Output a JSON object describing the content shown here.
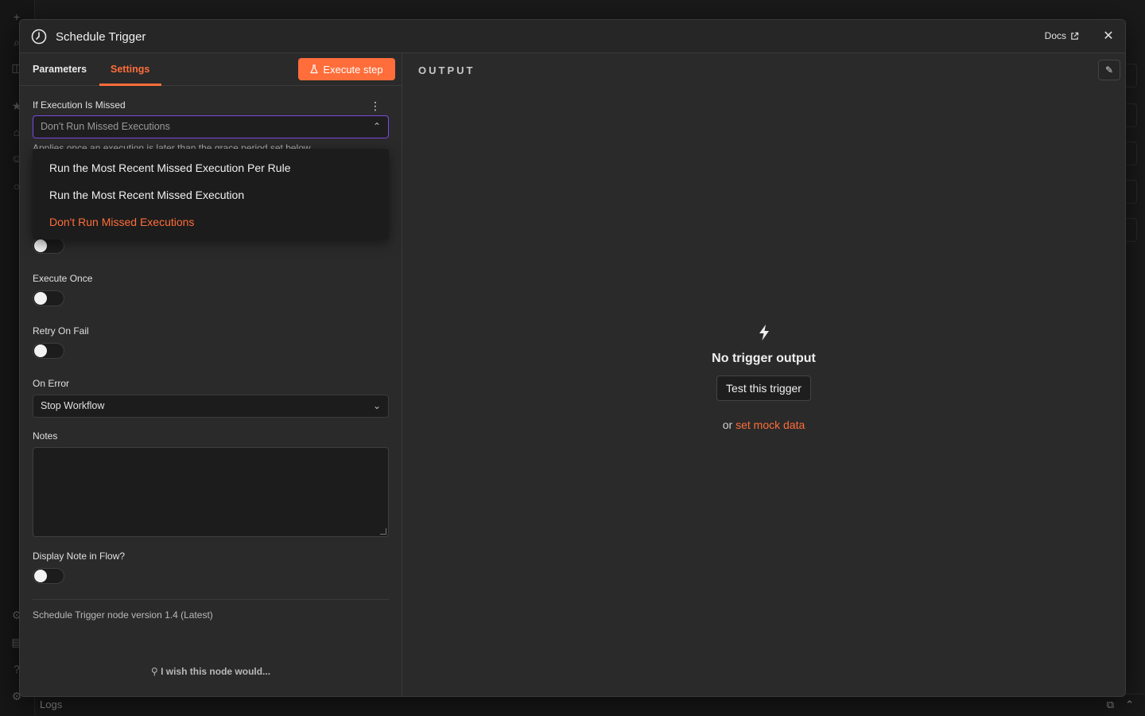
{
  "modal": {
    "title": "Schedule Trigger",
    "docs_label": "Docs"
  },
  "tabs": [
    {
      "label": "Parameters"
    },
    {
      "label": "Settings"
    }
  ],
  "execute_button": "Execute step",
  "missed": {
    "label": "If Execution Is Missed",
    "value": "Don't Run Missed Executions",
    "hint": "Applies once an execution is later than the grace period set below",
    "options": [
      "Run the Most Recent Missed Execution Per Rule",
      "Run the Most Recent Missed Execution",
      "Don't Run Missed Executions"
    ],
    "selected_option": "Don't Run Missed Executions"
  },
  "fields": {
    "execute_once": "Execute Once",
    "retry_on_fail": "Retry On Fail",
    "on_error": "On Error",
    "on_error_value": "Stop Workflow",
    "notes": "Notes",
    "display_note": "Display Note in Flow?"
  },
  "toggles": {
    "hidden_toggle": false,
    "execute_once": false,
    "retry_on_fail": false,
    "display_note": false
  },
  "footer": {
    "version": "Schedule Trigger node version 1.4 (Latest)",
    "wish": "I wish this node would..."
  },
  "output": {
    "label": "OUTPUT",
    "empty_title": "No trigger output",
    "test_button": "Test this trigger",
    "or_text": "or",
    "mock_link": "set mock data"
  },
  "logs": {
    "label": "Logs"
  },
  "colors": {
    "accent": "#ff6d3a",
    "focus_border": "#7a4ae0",
    "panel_bg": "#2a2a2a"
  }
}
